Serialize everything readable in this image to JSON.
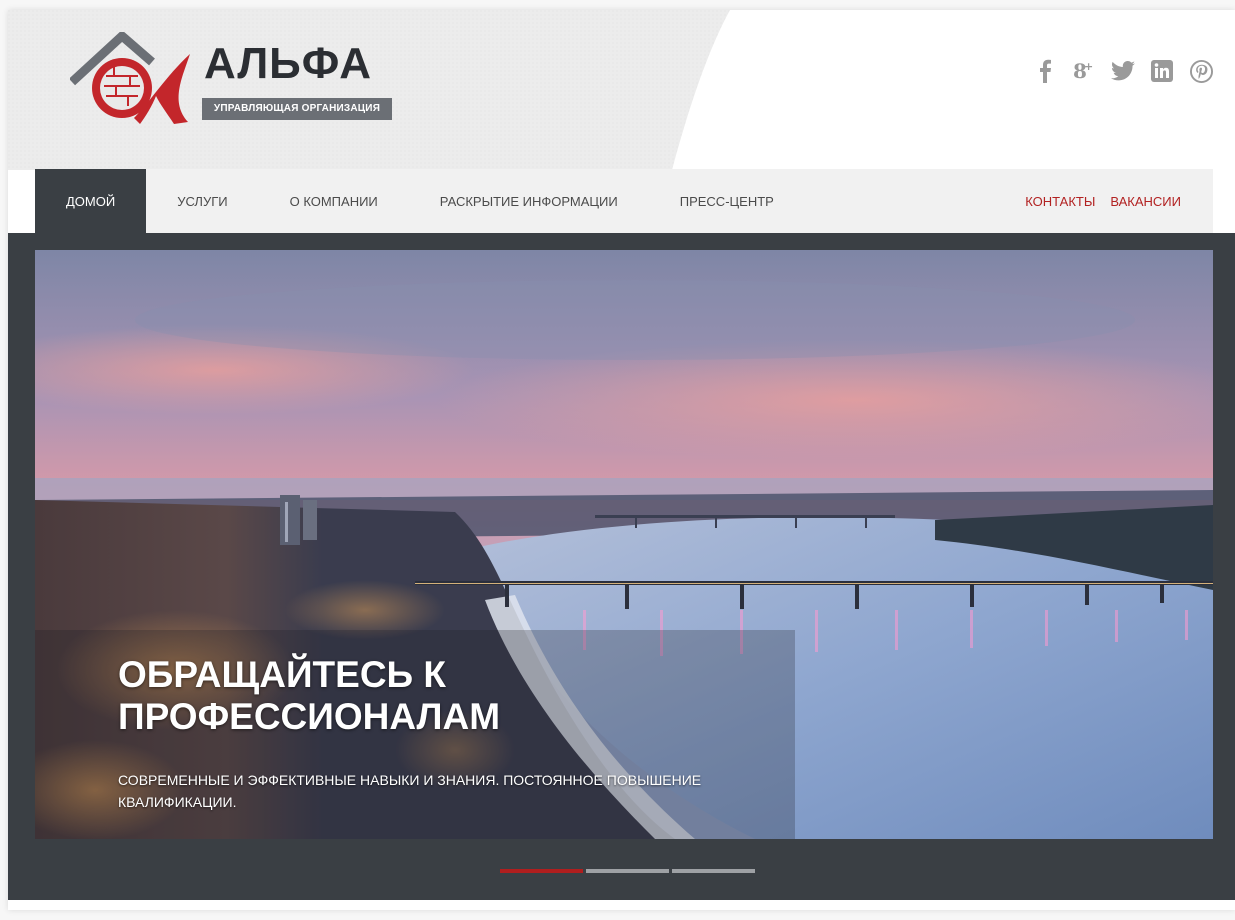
{
  "brand": {
    "name": "АЛЬФА",
    "tagline": "УПРАВЛЯЮЩАЯ ОРГАНИЗАЦИЯ"
  },
  "social": [
    {
      "name": "facebook-icon",
      "glyph": "f"
    },
    {
      "name": "google-plus-icon",
      "glyph": "g+"
    },
    {
      "name": "twitter-icon",
      "glyph": "🐦"
    },
    {
      "name": "linkedin-icon",
      "glyph": "in"
    },
    {
      "name": "pinterest-icon",
      "glyph": "P"
    }
  ],
  "nav": {
    "items": [
      {
        "label": "ДОМОЙ",
        "active": true
      },
      {
        "label": "УСЛУГИ",
        "active": false
      },
      {
        "label": "О КОМПАНИИ",
        "active": false
      },
      {
        "label": "РАСКРЫТИЕ ИНФОРМАЦИИ",
        "active": false
      },
      {
        "label": "ПРЕСС-ЦЕНТР",
        "active": false
      }
    ],
    "right": [
      "КОНТАКТЫ",
      "ВАКАНСИИ"
    ]
  },
  "slider": {
    "title_line1": "ОБРАЩАЙТЕСЬ К",
    "title_line2": "ПРОФЕССИОНАЛАМ",
    "subtitle_line1": "СОВРЕМЕННЫЕ И ЭФФЕКТИВНЫЕ НАВЫКИ И ЗНАНИЯ. ПОСТОЯННОЕ ПОВЫШЕНИЕ",
    "subtitle_line2": "КВАЛИФИКАЦИИ.",
    "slide_count": 3,
    "active_slide": 1
  },
  "colors": {
    "accent": "#b01e1e",
    "nav_active": "#3a3f44",
    "band": "#3a3f44",
    "nav_link": "#b22222"
  }
}
